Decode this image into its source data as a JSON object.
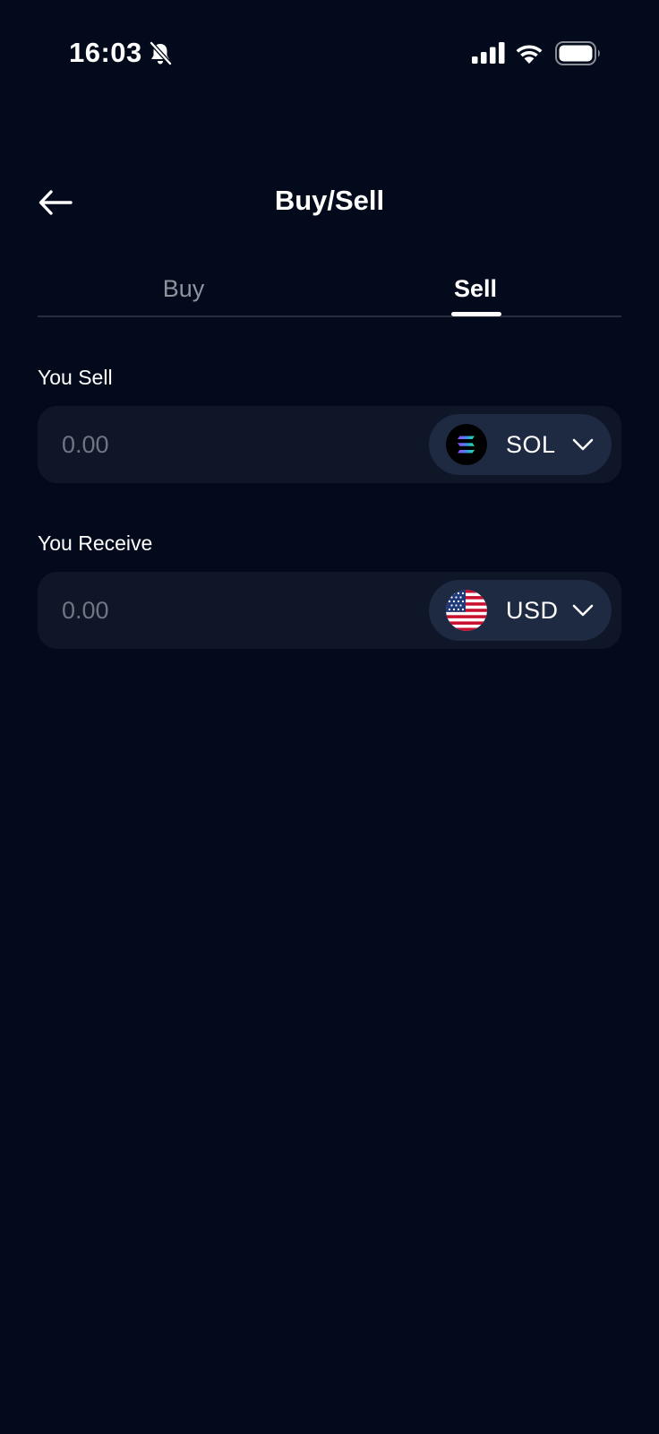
{
  "status_bar": {
    "time": "16:03"
  },
  "header": {
    "title": "Buy/Sell"
  },
  "tabs": [
    {
      "label": "Buy",
      "active": false
    },
    {
      "label": "Sell",
      "active": true
    }
  ],
  "sell_field": {
    "label": "You Sell",
    "placeholder": "0.00",
    "value": "",
    "currency": "SOL",
    "icon": "solana-icon"
  },
  "receive_field": {
    "label": "You Receive",
    "placeholder": "0.00",
    "value": "",
    "currency": "USD",
    "icon": "us-flag-icon"
  },
  "colors": {
    "background": "#020a1b",
    "field_background": "#0f1628",
    "selector_background": "#1e2942",
    "inactive_tab": "#8f939e",
    "placeholder": "#6f7582"
  }
}
